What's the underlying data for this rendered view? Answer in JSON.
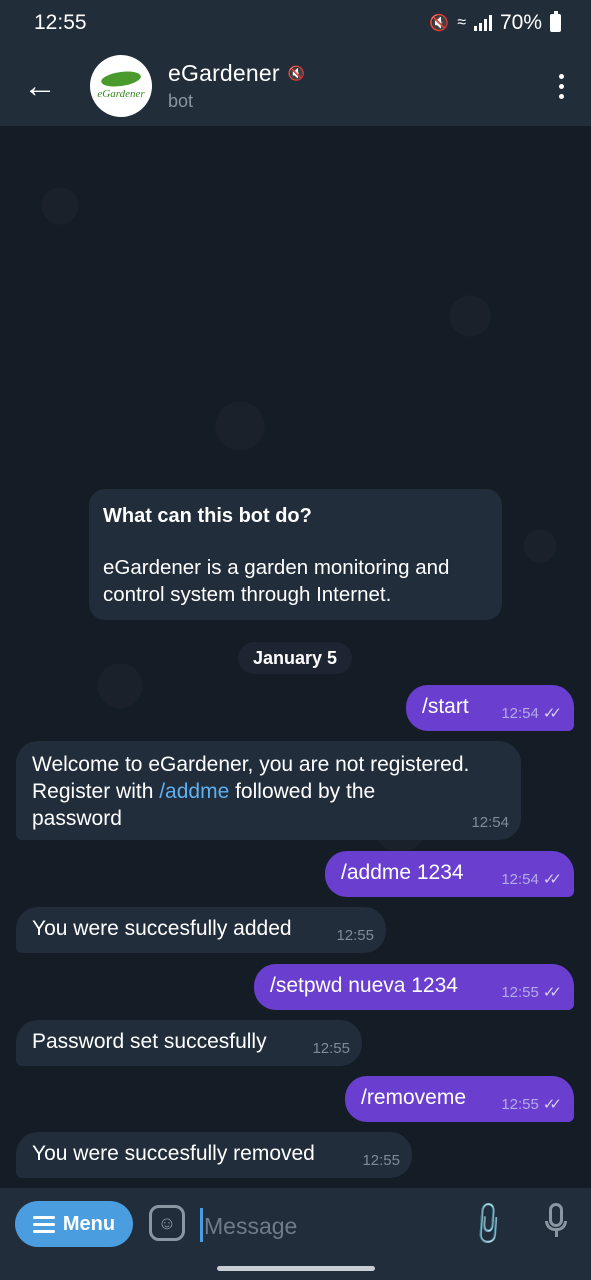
{
  "status_bar": {
    "time": "12:55",
    "battery": "70%",
    "icons": [
      "mute-icon",
      "wifi-icon",
      "signal-icon",
      "battery-icon"
    ]
  },
  "header": {
    "title": "eGardener",
    "subtitle": "bot",
    "avatar_text": "eGardener",
    "icons": [
      "back-arrow-icon",
      "muted-icon",
      "more-vertical-icon"
    ]
  },
  "info_card": {
    "title": "What can this bot do?",
    "body": "eGardener is a garden monitoring and control system through Internet."
  },
  "date_chip": "January 5",
  "messages": [
    {
      "direction": "out",
      "text": "/start",
      "time": "12:54",
      "status": "read"
    },
    {
      "direction": "in",
      "text_parts": [
        "Welcome to eGardener, you are not registered.",
        "Register with ",
        "/addme",
        " followed by the",
        "password"
      ],
      "time": "12:54"
    },
    {
      "direction": "out",
      "text": "/addme 1234",
      "time": "12:54",
      "status": "read"
    },
    {
      "direction": "in",
      "text": "You were succesfully added",
      "time": "12:55"
    },
    {
      "direction": "out",
      "text": "/setpwd nueva 1234",
      "time": "12:55",
      "status": "read"
    },
    {
      "direction": "in",
      "text": "Password set succesfully",
      "time": "12:55"
    },
    {
      "direction": "out",
      "text": "/removeme",
      "time": "12:55",
      "status": "read"
    },
    {
      "direction": "in",
      "text": "You were succesfully removed",
      "time": "12:55"
    }
  ],
  "input_bar": {
    "menu_label": "Menu",
    "placeholder": "Message",
    "icons": [
      "hamburger-icon",
      "sticker-icon",
      "paperclip-icon",
      "microphone-icon"
    ]
  },
  "colors": {
    "header_bg": "#222d3a",
    "chat_bg": "#141c26",
    "outgoing_bubble": "#6a3fd0",
    "incoming_bubble": "#212d3b",
    "link": "#5fb0f0",
    "menu_button": "#4a9ee0"
  }
}
